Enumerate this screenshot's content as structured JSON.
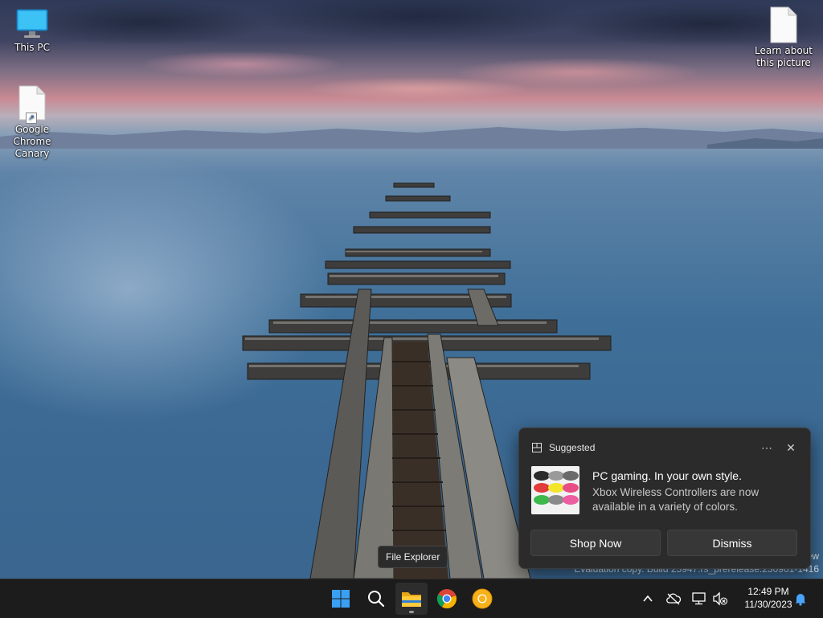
{
  "desktop": {
    "icons": [
      {
        "label": "This PC",
        "icon": "this-pc-icon"
      },
      {
        "label": "Google Chrome Canary",
        "icon": "file-icon"
      },
      {
        "label": "Learn about this picture",
        "icon": "file-icon"
      }
    ]
  },
  "watermark": {
    "line1": "ew",
    "line2": "Evaluation copy. Build 25947.rs_prerelease.230901-1416"
  },
  "notification": {
    "app_name": "Suggested",
    "title": "PC gaming. In your own style.",
    "body": "Xbox Wireless Controllers are now available in a variety of colors.",
    "actions": {
      "primary": "Shop Now",
      "secondary": "Dismiss"
    },
    "more_icon": "more-icon",
    "close_icon": "close-icon",
    "image": "xbox-controllers-image"
  },
  "tooltip": {
    "text": "File Explorer"
  },
  "taskbar": {
    "apps": [
      {
        "name": "Start",
        "icon": "windows-start-icon"
      },
      {
        "name": "Search",
        "icon": "search-icon"
      },
      {
        "name": "File Explorer",
        "icon": "folder-icon",
        "active": true
      },
      {
        "name": "Google Chrome",
        "icon": "chrome-icon"
      },
      {
        "name": "Google Chrome Canary",
        "icon": "chrome-canary-icon"
      }
    ],
    "tray": {
      "show_hidden_icon": "chevron-up-icon",
      "onedrive_icon": "cloud-offline-icon",
      "network_icon": "network-icon",
      "volume_icon": "volume-muted-icon",
      "notification_icon": "bell-icon"
    },
    "clock": {
      "time": "12:49 PM",
      "date": "11/30/2023"
    }
  },
  "colors": {
    "taskbar_bg": "#1c1c1c",
    "toast_bg": "#2b2b2b",
    "accent_blue": "#0078d4"
  }
}
